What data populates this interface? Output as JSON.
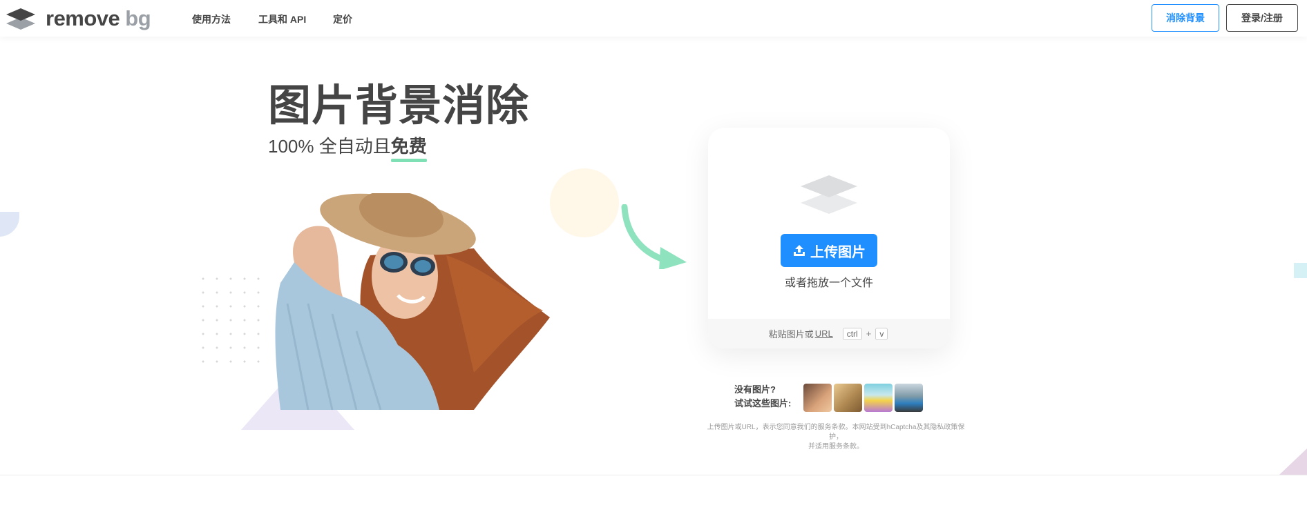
{
  "header": {
    "logo": {
      "word1": "remove",
      "word2": "bg"
    },
    "nav": [
      {
        "label": "使用方法"
      },
      {
        "label": "工具和 API"
      },
      {
        "label": "定价"
      }
    ],
    "remove_bg_button": "消除背景",
    "login_button": "登录/注册"
  },
  "hero": {
    "title": "图片背景消除",
    "subtitle_prefix": "100% 全自动且",
    "subtitle_emphasis": "免费"
  },
  "upload": {
    "button_label": "上传图片",
    "drop_text": "或者拖放一个文件",
    "paste_text": "粘贴图片或",
    "url_label": "URL",
    "key_ctrl": "ctrl",
    "key_plus": "+",
    "key_v": "v"
  },
  "samples": {
    "line1": "没有图片?",
    "line2": "试试这些图片:"
  },
  "terms": {
    "line1": "上传图片或URL，表示您同意我们的服务条款。本网站受到hCaptcha及其隐私政策保护，",
    "line2": "并适用服务条款。"
  },
  "colors": {
    "accent": "#1f8fff",
    "text": "#454545",
    "highlight": "#7fe0b6"
  }
}
